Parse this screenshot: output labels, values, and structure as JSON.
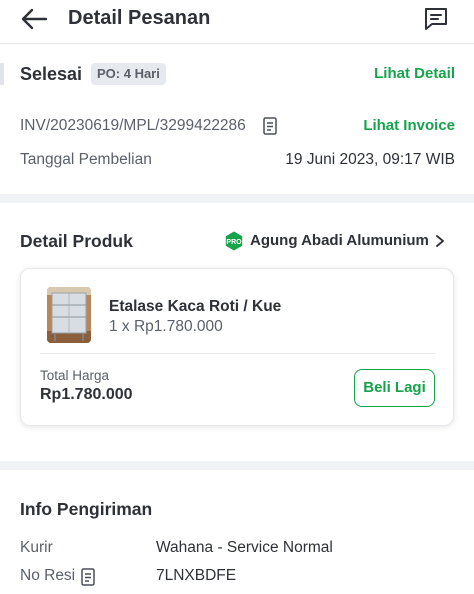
{
  "header": {
    "title": "Detail Pesanan",
    "back_icon": "arrow-left-icon",
    "chat_icon": "chat-icon"
  },
  "order_status": {
    "status": "Selesai",
    "po_badge": "PO: 4 Hari",
    "detail_link": "Lihat Detail"
  },
  "invoice": {
    "number": "INV/20230619/MPL/3299422286",
    "link": "Lihat Invoice"
  },
  "purchase_date": {
    "label": "Tanggal Pembelian",
    "value": "19 Juni 2023, 09:17 WIB"
  },
  "product_detail": {
    "title": "Detail Produk",
    "seller": {
      "badge": "PRO",
      "name": "Agung Abadi Alumunium"
    },
    "item": {
      "name": "Etalase Kaca Roti / Kue",
      "quantity_price": "1 x Rp1.780.000"
    },
    "total_label": "Total Harga",
    "total_value": "Rp1.780.000",
    "buy_again": "Beli Lagi"
  },
  "shipping": {
    "title": "Info Pengiriman",
    "courier_label": "Kurir",
    "courier_value": "Wahana - Service Normal",
    "receipt_label": "No Resi",
    "receipt_value": "7LNXBDFE"
  },
  "colors": {
    "accent": "#16a34a",
    "text_primary": "#2e3137",
    "text_secondary": "#5b606a",
    "divider": "#f0f2f5"
  }
}
